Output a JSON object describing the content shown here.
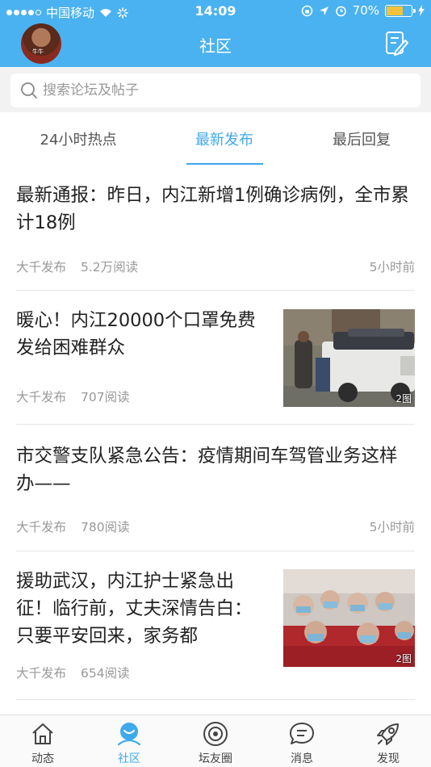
{
  "status_bar": {
    "carrier": "中国移动",
    "time": "14:09",
    "battery": "70%",
    "battery_level": 0.7
  },
  "nav": {
    "title": "社区",
    "avatar_tag": "牛牛"
  },
  "search": {
    "placeholder": "搜索论坛及帖子"
  },
  "tabs": [
    {
      "label": "24小时热点",
      "active": false
    },
    {
      "label": "最新发布",
      "active": true
    },
    {
      "label": "最后回复",
      "active": false
    }
  ],
  "posts": [
    {
      "title": "最新通报：昨日，内江新增1例确诊病例，全市累计18例",
      "source": "大千发布",
      "reads": "5.2万阅读",
      "time": "5小时前"
    },
    {
      "title": "暖心！内江20000个口罩免费发给困难群众",
      "source": "大千发布",
      "reads": "707阅读",
      "badge": "2图"
    },
    {
      "title": "市交警支队紧急公告：疫情期间车驾管业务这样办——",
      "source": "大千发布",
      "reads": "780阅读",
      "time": "5小时前"
    },
    {
      "title": "援助武汉，内江护士紧急出征！临行前，丈夫深情告白：只要平安回来，家务都",
      "source": "大千发布",
      "reads": "654阅读",
      "badge": "2图"
    }
  ],
  "tabbar": [
    {
      "label": "动态",
      "icon": "house-icon"
    },
    {
      "label": "社区",
      "icon": "community-icon",
      "active": true
    },
    {
      "label": "坛友圈",
      "icon": "circle-icon"
    },
    {
      "label": "消息",
      "icon": "chat-icon"
    },
    {
      "label": "发现",
      "icon": "rocket-icon"
    }
  ],
  "colors": {
    "header": "#4ab2f0",
    "accent": "#3fa9ee",
    "battery": "#f4c23a"
  }
}
